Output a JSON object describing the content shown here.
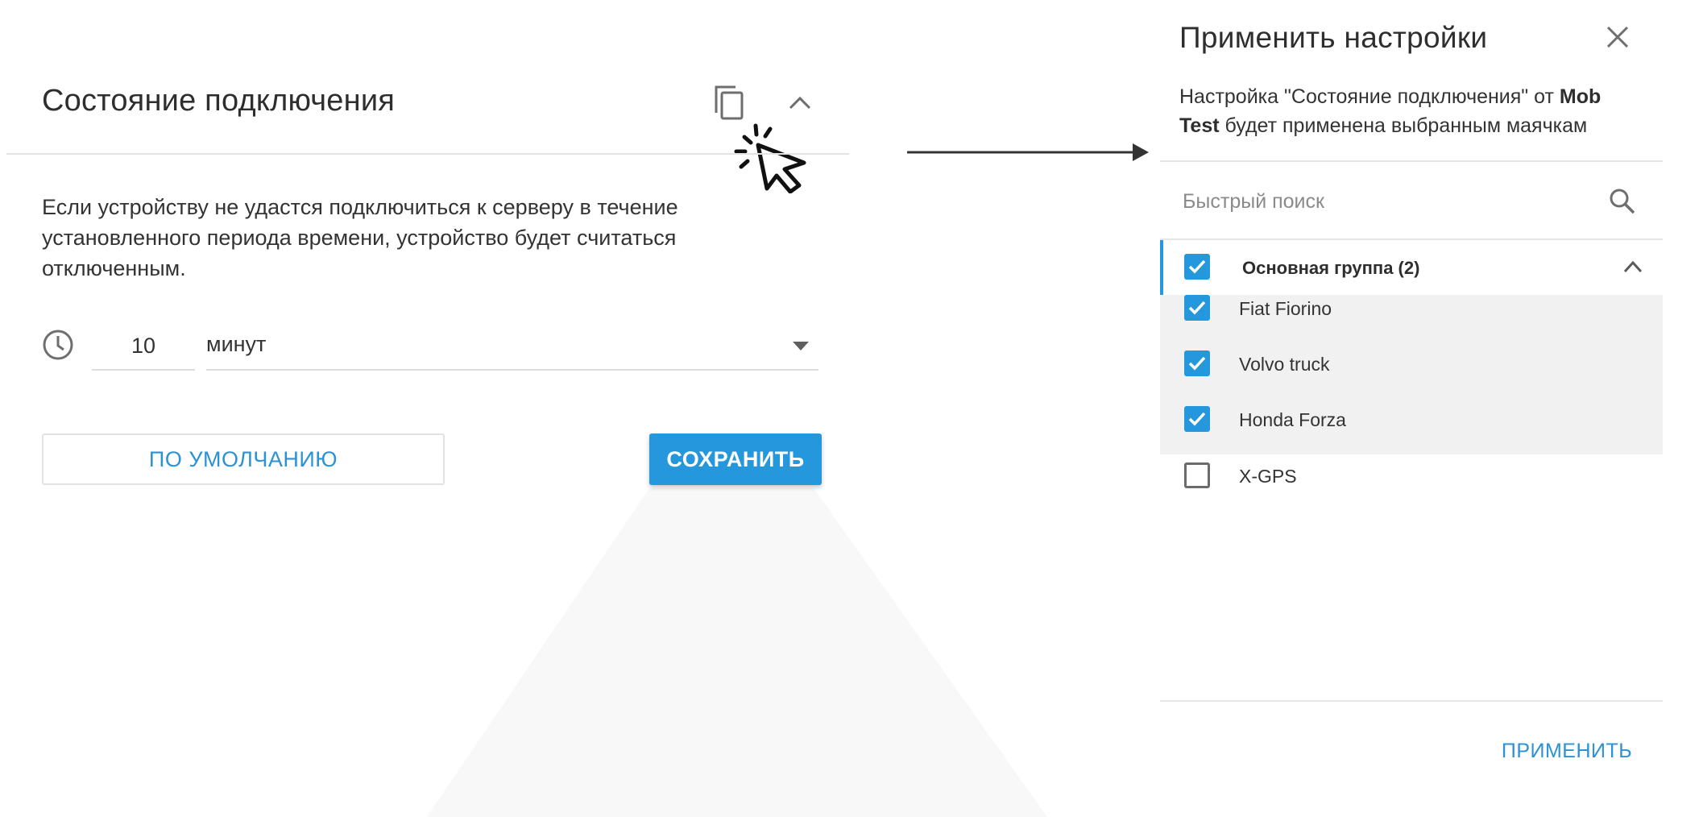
{
  "connection_card": {
    "title": "Состояние подключения",
    "description": "Если устройству не удастся подключиться к серверу в течение установленного периода времени, устройство будет считаться отключенным.",
    "timeout_value": "10",
    "timeout_unit": "минут",
    "default_button": "ПО УМОЛЧАНИЮ",
    "save_button": "СОХРАНИТЬ"
  },
  "apply_panel": {
    "title": "Применить настройки",
    "desc_part1": "Настройка \"Состояние подключения\" от ",
    "desc_bold": "Mob Test",
    "desc_part2": " будет применена выбранным маячкам",
    "search_placeholder": "Быстрый поиск",
    "group": {
      "label": "Основная группа (2)",
      "checked": true
    },
    "items": [
      {
        "label": "Fiat Fiorino",
        "checked": true
      },
      {
        "label": "Volvo truck",
        "checked": true
      },
      {
        "label": "Honda Forza",
        "checked": true
      },
      {
        "label": "X-GPS",
        "checked": false
      }
    ],
    "apply_button": "ПРИМЕНИТЬ"
  },
  "colors": {
    "accent": "#2597dd",
    "text": "#333333",
    "divider": "#e5e5e5",
    "selected_rows_bg": "#f1f1f1"
  },
  "icons": [
    "copy-icon",
    "chevron-up-icon",
    "cursor-click-icon",
    "clock-icon",
    "caret-down-icon",
    "close-icon",
    "search-icon",
    "checkbox-icon",
    "arrow-right-icon"
  ]
}
